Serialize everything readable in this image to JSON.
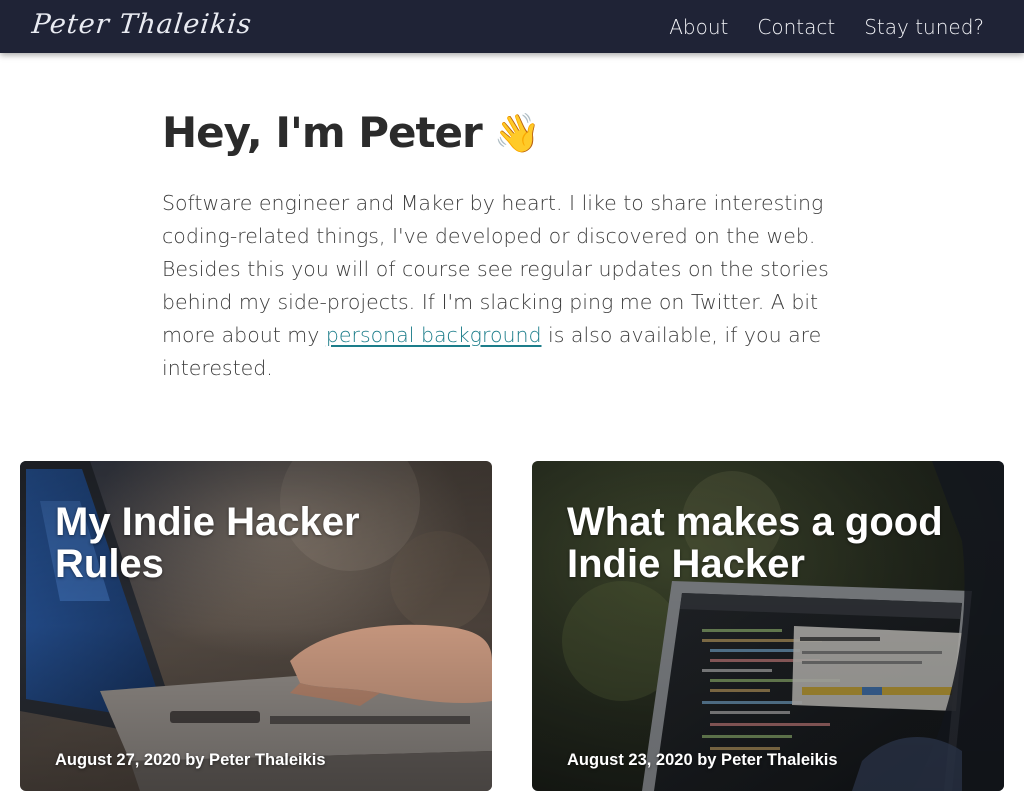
{
  "header": {
    "brand": "Peter Thaleikis",
    "nav": [
      {
        "label": "About"
      },
      {
        "label": "Contact"
      },
      {
        "label": "Stay tuned?"
      }
    ]
  },
  "intro": {
    "heading": "Hey, I'm Peter",
    "heading_emoji": "👋",
    "text_before_link": "Software engineer and Maker by heart. I like to share interesting coding-related things, I've developed or discovered on the web. Besides this you will of course see regular updates on the stories behind my side-projects. If I'm slacking ping me on Twitter. A bit more about my ",
    "link_text": "personal background",
    "text_after_link": " is also available, if you are interested."
  },
  "posts": [
    {
      "title": "My Indie Hacker Rules",
      "meta": "August 27, 2020 by Peter Thaleikis",
      "image": "laptop-typing-photo"
    },
    {
      "title": "What makes a good Indie Hacker",
      "meta": "August 23, 2020 by Peter Thaleikis",
      "image": "laptop-code-screen-photo"
    }
  ],
  "colors": {
    "header_bg": "#1f2336",
    "link": "#1c7d8a",
    "heading": "#2b2b2b",
    "body_text": "#3c3c3c"
  }
}
